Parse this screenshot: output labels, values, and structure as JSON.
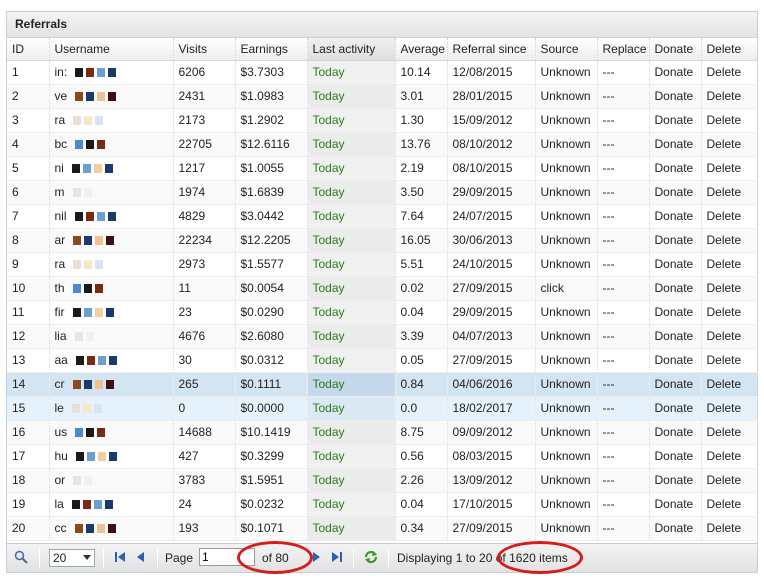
{
  "panel": {
    "title": "Referrals"
  },
  "columns": [
    "ID",
    "Username",
    "Visits",
    "Earnings",
    "Last activity",
    "Average",
    "Referral since",
    "Source",
    "Replace",
    "Donate",
    "Delete"
  ],
  "rows": [
    {
      "id": "1",
      "username": "in:",
      "visits": "6206",
      "earnings": "$3.7303",
      "activity": "Today",
      "average": "10.14",
      "since": "12/08/2015",
      "source": "Unknown",
      "replace": "---",
      "donate": "Donate",
      "delete": "Delete"
    },
    {
      "id": "2",
      "username": "ve",
      "visits": "2431",
      "earnings": "$1.0983",
      "activity": "Today",
      "average": "3.01",
      "since": "28/01/2015",
      "source": "Unknown",
      "replace": "---",
      "donate": "Donate",
      "delete": "Delete"
    },
    {
      "id": "3",
      "username": "ra",
      "visits": "2173",
      "earnings": "$1.2902",
      "activity": "Today",
      "average": "1.30",
      "since": "15/09/2012",
      "source": "Unknown",
      "replace": "---",
      "donate": "Donate",
      "delete": "Delete"
    },
    {
      "id": "4",
      "username": "bc",
      "visits": "22705",
      "earnings": "$12.6116",
      "activity": "Today",
      "average": "13.76",
      "since": "08/10/2012",
      "source": "Unknown",
      "replace": "---",
      "donate": "Donate",
      "delete": "Delete"
    },
    {
      "id": "5",
      "username": "ni",
      "visits": "1217",
      "earnings": "$1.0055",
      "activity": "Today",
      "average": "2.19",
      "since": "08/10/2015",
      "source": "Unknown",
      "replace": "---",
      "donate": "Donate",
      "delete": "Delete"
    },
    {
      "id": "6",
      "username": "m",
      "visits": "1974",
      "earnings": "$1.6839",
      "activity": "Today",
      "average": "3.50",
      "since": "29/09/2015",
      "source": "Unknown",
      "replace": "---",
      "donate": "Donate",
      "delete": "Delete"
    },
    {
      "id": "7",
      "username": "nil",
      "visits": "4829",
      "earnings": "$3.0442",
      "activity": "Today",
      "average": "7.64",
      "since": "24/07/2015",
      "source": "Unknown",
      "replace": "---",
      "donate": "Donate",
      "delete": "Delete"
    },
    {
      "id": "8",
      "username": "ar",
      "visits": "22234",
      "earnings": "$12.2205",
      "activity": "Today",
      "average": "16.05",
      "since": "30/06/2013",
      "source": "Unknown",
      "replace": "---",
      "donate": "Donate",
      "delete": "Delete"
    },
    {
      "id": "9",
      "username": "ra",
      "visits": "2973",
      "earnings": "$1.5577",
      "activity": "Today",
      "average": "5.51",
      "since": "24/10/2015",
      "source": "Unknown",
      "replace": "---",
      "donate": "Donate",
      "delete": "Delete"
    },
    {
      "id": "10",
      "username": "th",
      "visits": "11",
      "earnings": "$0.0054",
      "activity": "Today",
      "average": "0.02",
      "since": "27/09/2015",
      "source": "click",
      "replace": "---",
      "donate": "Donate",
      "delete": "Delete"
    },
    {
      "id": "11",
      "username": "fir",
      "visits": "23",
      "earnings": "$0.0290",
      "activity": "Today",
      "average": "0.04",
      "since": "29/09/2015",
      "source": "Unknown",
      "replace": "---",
      "donate": "Donate",
      "delete": "Delete"
    },
    {
      "id": "12",
      "username": "lia",
      "visits": "4676",
      "earnings": "$2.6080",
      "activity": "Today",
      "average": "3.39",
      "since": "04/07/2013",
      "source": "Unknown",
      "replace": "---",
      "donate": "Donate",
      "delete": "Delete"
    },
    {
      "id": "13",
      "username": "aa",
      "visits": "30",
      "earnings": "$0.0312",
      "activity": "Today",
      "average": "0.05",
      "since": "27/09/2015",
      "source": "Unknown",
      "replace": "---",
      "donate": "Donate",
      "delete": "Delete"
    },
    {
      "id": "14",
      "username": "cr",
      "visits": "265",
      "earnings": "$0.1111",
      "activity": "Today",
      "average": "0.84",
      "since": "04/06/2016",
      "source": "Unknown",
      "replace": "---",
      "donate": "Donate",
      "delete": "Delete"
    },
    {
      "id": "15",
      "username": "le",
      "visits": "0",
      "earnings": "$0.0000",
      "activity": "Today",
      "average": "0.0",
      "since": "18/02/2017",
      "source": "Unknown",
      "replace": "---",
      "donate": "Donate",
      "delete": "Delete"
    },
    {
      "id": "16",
      "username": "us",
      "visits": "14688",
      "earnings": "$10.1419",
      "activity": "Today",
      "average": "8.75",
      "since": "09/09/2012",
      "source": "Unknown",
      "replace": "---",
      "donate": "Donate",
      "delete": "Delete"
    },
    {
      "id": "17",
      "username": "hu",
      "visits": "427",
      "earnings": "$0.3299",
      "activity": "Today",
      "average": "0.56",
      "since": "08/03/2015",
      "source": "Unknown",
      "replace": "---",
      "donate": "Donate",
      "delete": "Delete"
    },
    {
      "id": "18",
      "username": "or",
      "visits": "3783",
      "earnings": "$1.5951",
      "activity": "Today",
      "average": "2.26",
      "since": "13/09/2012",
      "source": "Unknown",
      "replace": "---",
      "donate": "Donate",
      "delete": "Delete"
    },
    {
      "id": "19",
      "username": "la",
      "visits": "24",
      "earnings": "$0.0232",
      "activity": "Today",
      "average": "0.04",
      "since": "17/10/2015",
      "source": "Unknown",
      "replace": "---",
      "donate": "Donate",
      "delete": "Delete"
    },
    {
      "id": "20",
      "username": "cc",
      "visits": "193",
      "earnings": "$0.1071",
      "activity": "Today",
      "average": "0.34",
      "since": "27/09/2015",
      "source": "Unknown",
      "replace": "---",
      "donate": "Donate",
      "delete": "Delete"
    }
  ],
  "selected_row_id": "14",
  "hover_row_id": "15",
  "pager": {
    "page_size": "20",
    "page_label": "Page",
    "page_value": "1",
    "of_label": "of 80",
    "display_text": "Displaying 1 to 20 of 1620 items"
  },
  "colors": {
    "activity_text": "#2a7a1a",
    "selected_row": "#d3e4f3",
    "highlight_oval": "#d41d1d",
    "pager_icons": "#2f5fb3",
    "refresh_icon": "#3a9a2a"
  },
  "icons": {
    "search": "search-icon",
    "first": "first-page-icon",
    "prev": "prev-page-icon",
    "next": "next-page-icon",
    "last": "last-page-icon",
    "refresh": "refresh-icon"
  }
}
